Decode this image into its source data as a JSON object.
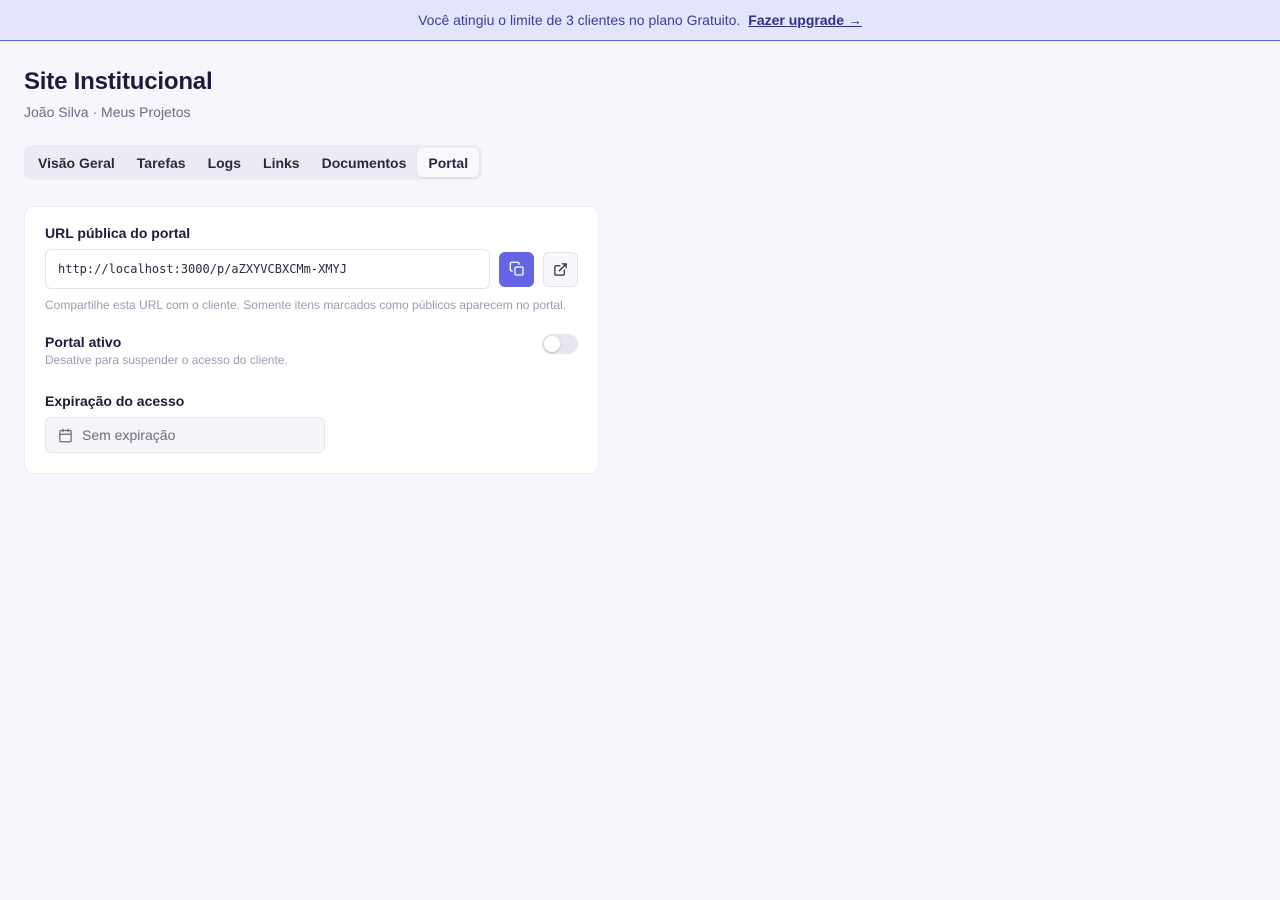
{
  "banner": {
    "message": "Você atingiu o limite de 3 clientes no plano Gratuito.",
    "upgrade_link": "Fazer upgrade →"
  },
  "header": {
    "title": "Site Institucional",
    "subtitle": "João Silva · Meus Projetos"
  },
  "tabs": [
    {
      "label": "Visão Geral",
      "active": false
    },
    {
      "label": "Tarefas",
      "active": false
    },
    {
      "label": "Logs",
      "active": false
    },
    {
      "label": "Links",
      "active": false
    },
    {
      "label": "Documentos",
      "active": false
    },
    {
      "label": "Portal",
      "active": true
    }
  ],
  "portal": {
    "url_label": "URL pública do portal",
    "url_value": "http://localhost:3000/p/aZXYVCBXCMm-XMYJ",
    "copy_icon": "copy-icon",
    "open_icon": "external-link-icon",
    "hint": "Compartilhe esta URL com o cliente. Somente itens marcados como públicos aparecem no portal.",
    "active_label": "Portal ativo",
    "active_desc": "Desative para suspender o acesso do cliente.",
    "active_on": false,
    "expiration_label": "Expiração do acesso",
    "expiration_value": "Sem expiração",
    "calendar_icon": "calendar-icon"
  },
  "colors": {
    "accent": "#6664e6",
    "banner_bg": "#e3e6fb",
    "page_bg": "#f6f6fc"
  }
}
